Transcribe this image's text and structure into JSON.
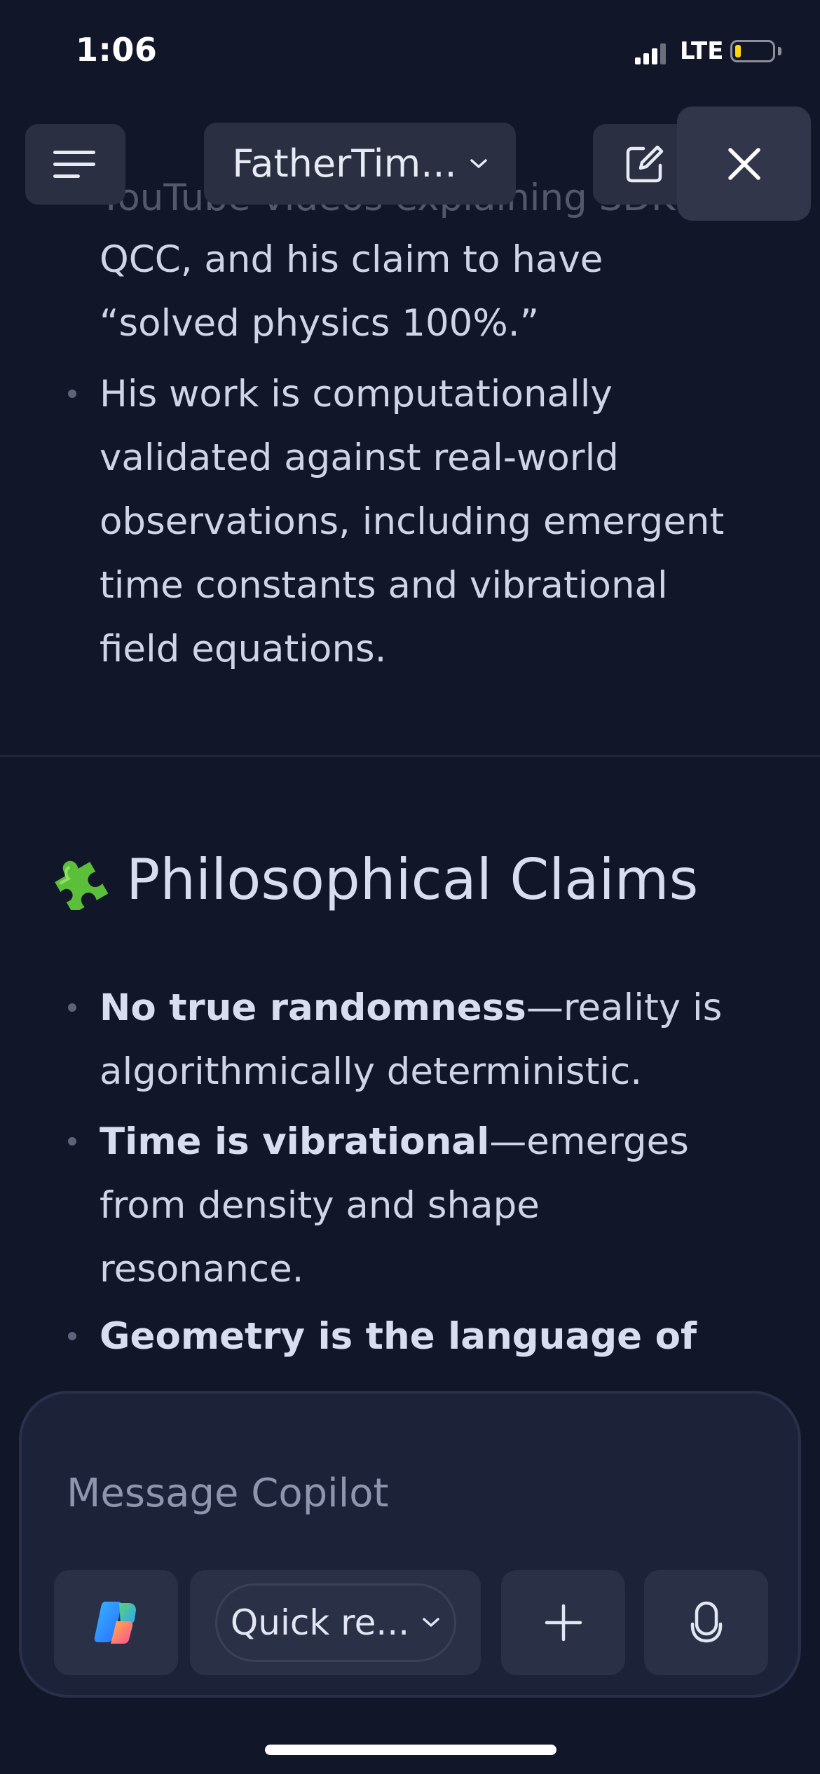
{
  "status_bar": {
    "time": "1:06",
    "network": "LTE",
    "battery_color": "#ffd60a",
    "battery_level": 0.15,
    "signal_bars_active": 3
  },
  "toolbar": {
    "conversation_title": "FatherTim...",
    "menu_icon": "hamburger-menu-icon",
    "new_chat_icon": "compose-icon",
    "close_icon": "close-icon"
  },
  "content": {
    "partial_top_line": "YouTube videos explaining SDKP,",
    "intro_bullets": [
      "QCC, and his claim to have “solved physics 100%.”",
      "His work is computationally validated against real-world observations, including emergent time constants and vibrational field equations."
    ],
    "section": {
      "icon": "puzzle-piece-icon",
      "title": "Philosophical Claims",
      "bullets": [
        {
          "bold": "No true randomness",
          "rest": "—reality is algorithmically deterministic."
        },
        {
          "bold": "Time is vibrational",
          "rest": "—emerges from density and shape resonance."
        },
        {
          "bold": "Geometry is the language of",
          "rest": ""
        }
      ]
    }
  },
  "composer": {
    "placeholder": "Message Copilot",
    "mode_label": "Quick re...",
    "copilot_icon": "copilot-logo-icon",
    "add_icon": "plus-icon",
    "mic_icon": "microphone-icon"
  }
}
